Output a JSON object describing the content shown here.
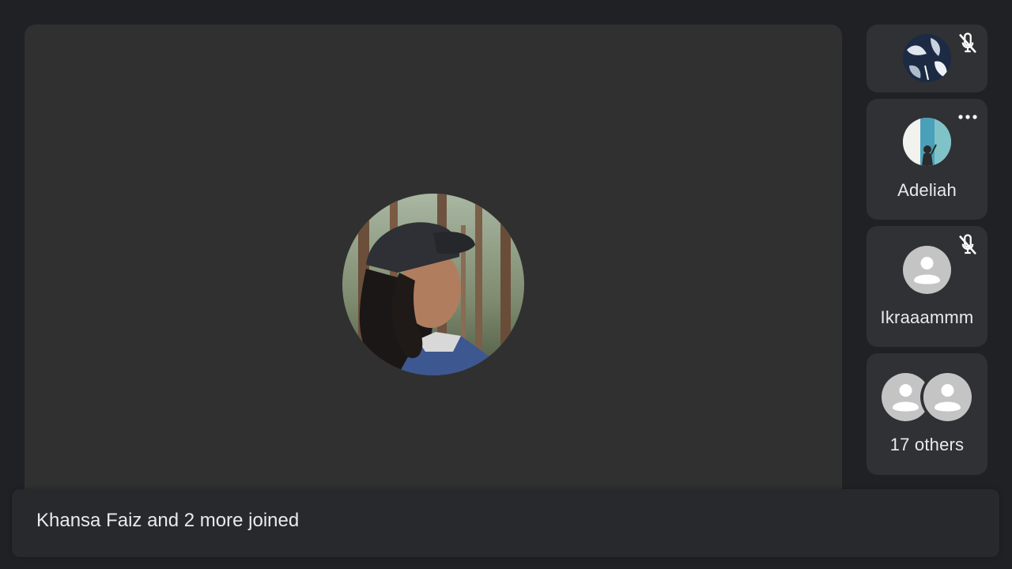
{
  "main": {
    "speaker_avatar": "profile-photo-man-cap"
  },
  "participants": [
    {
      "name": "",
      "muted": true,
      "avatar": "profile-photo-pattern"
    },
    {
      "name": "Adeliah",
      "muted": false,
      "avatar": "profile-photo-woman-waving",
      "more_icon": "more-horiz-icon"
    },
    {
      "name": "Ikraaammm",
      "muted": true,
      "avatar": "default-person-icon"
    }
  ],
  "others": {
    "label": "17 others",
    "avatar": "default-person-icon"
  },
  "notification": {
    "text": "Khansa Faiz and 2 more joined"
  },
  "colors": {
    "background": "#202124",
    "stage": "#303030",
    "tile": "#303134",
    "avatar_default": "#c4c4c4",
    "text": "#e8eaed"
  }
}
